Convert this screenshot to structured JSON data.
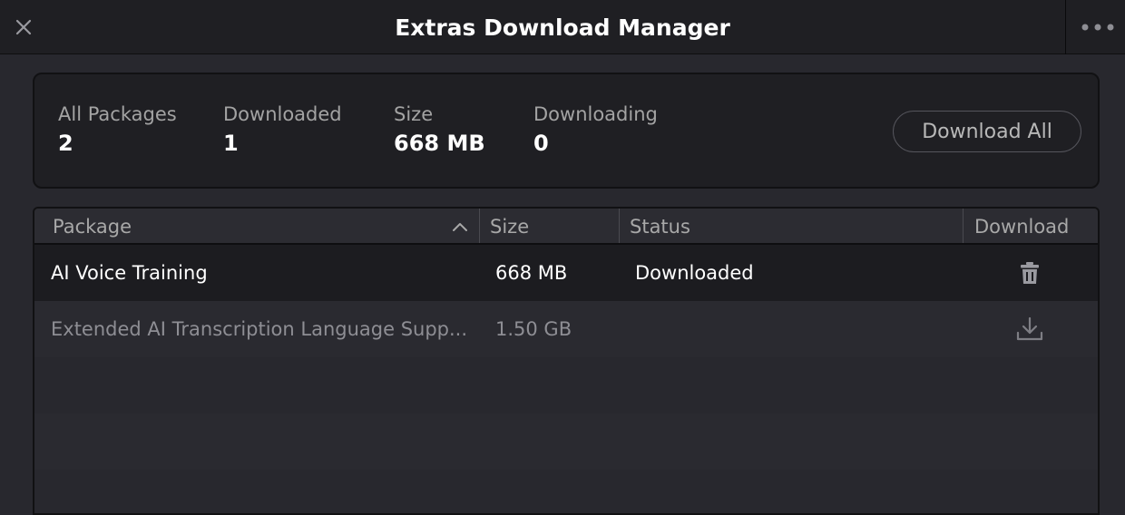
{
  "window": {
    "title": "Extras Download Manager",
    "close_icon": "close-icon",
    "more_icon": "more-horizontal-icon"
  },
  "summary": {
    "all_packages": {
      "label": "All Packages",
      "value": "2"
    },
    "downloaded": {
      "label": "Downloaded",
      "value": "1"
    },
    "size": {
      "label": "Size",
      "value": "668 MB"
    },
    "downloading": {
      "label": "Downloading",
      "value": "0"
    },
    "download_all_label": "Download All"
  },
  "table": {
    "columns": [
      {
        "label": "Package"
      },
      {
        "label": "Size"
      },
      {
        "label": "Status"
      },
      {
        "label": "Download"
      }
    ],
    "sort_icon": "chevron-up-icon",
    "rows": [
      {
        "package": "AI Voice Training",
        "size": "668 MB",
        "status": "Downloaded",
        "action_icon": "trash-icon"
      },
      {
        "package": "Extended AI Transcription Language Supp...",
        "size": "1.50 GB",
        "status": "",
        "action_icon": "download-icon"
      }
    ]
  },
  "colors": {
    "background": "#28282e",
    "panel": "#1f1f23",
    "selected_row": "#1c1c20",
    "text_primary": "#ffffff",
    "text_secondary": "#a3a3a3",
    "text_disabled": "#8e8e94"
  }
}
